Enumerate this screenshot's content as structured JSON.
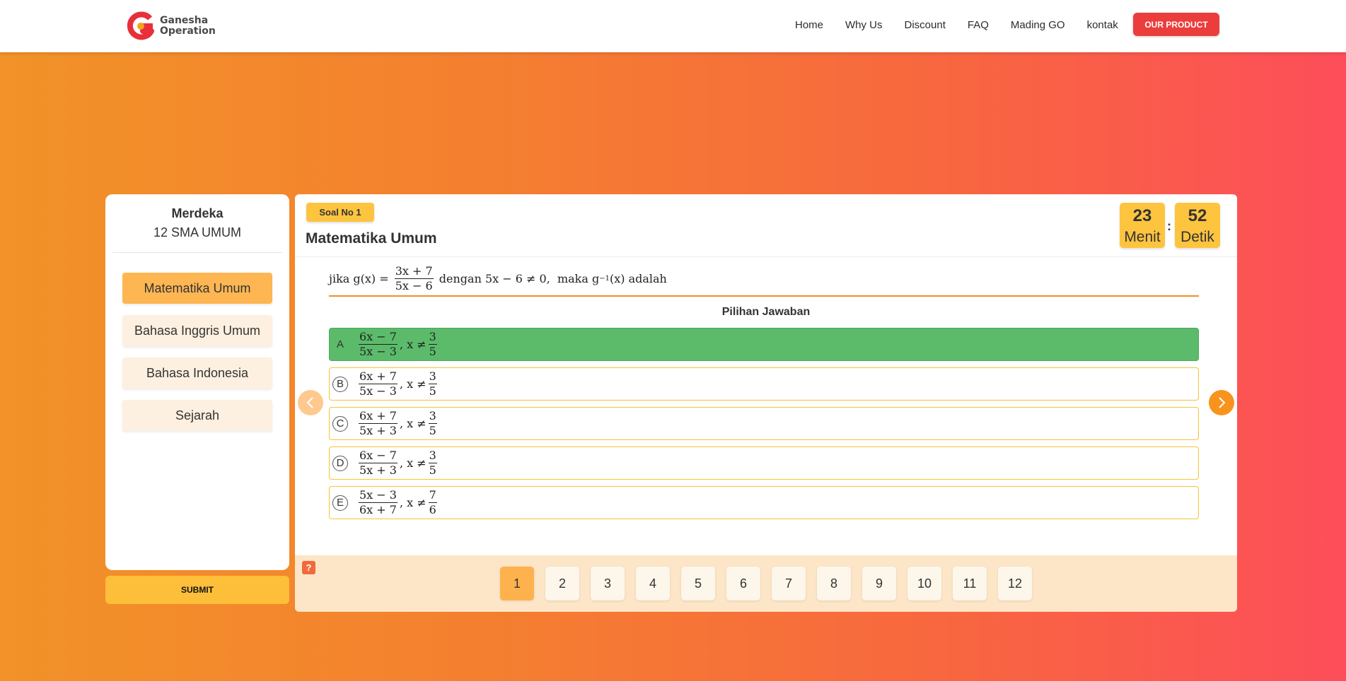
{
  "navbar": {
    "brand_line1": "Ganesha",
    "brand_line2": "Operation",
    "links": [
      "Home",
      "Why Us",
      "Discount",
      "FAQ",
      "Mading GO",
      "kontak"
    ],
    "cta_label": "OUR PRODUCT"
  },
  "sidebar": {
    "curriculum": "Merdeka",
    "class_name": "12 SMA UMUM",
    "subjects": [
      {
        "label": "Matematika Umum",
        "active": true
      },
      {
        "label": "Bahasa Inggris Umum",
        "active": false
      },
      {
        "label": "Bahasa Indonesia",
        "active": false
      },
      {
        "label": "Sejarah",
        "active": false
      }
    ],
    "submit_label": "SUBMIT"
  },
  "question": {
    "badge": "Soal No 1",
    "subject_title": "Matematika Umum",
    "text_prefix": "jika g(x) = ",
    "frac_num": "3x + 7",
    "frac_den": "5x − 6",
    "text_suffix": " dengan 5x − 6 ≠ 0,  maka g",
    "sup": "−1",
    "text_end": "(x) adalah"
  },
  "timer": {
    "minutes": "23",
    "minutes_label": "Menit",
    "seconds": "52",
    "seconds_label": "Detik",
    "separator": ":"
  },
  "answers": {
    "heading": "Pilihan Jawaban",
    "options": [
      {
        "letter": "A",
        "num": "6x − 7",
        "den": "5x − 3",
        "cond": ", x ≠",
        "cnum": "3",
        "cden": "5",
        "selected_correct": true
      },
      {
        "letter": "B",
        "num": "6x + 7",
        "den": "5x − 3",
        "cond": ", x ≠",
        "cnum": "3",
        "cden": "5",
        "selected_correct": false
      },
      {
        "letter": "C",
        "num": "6x + 7",
        "den": "5x + 3",
        "cond": ", x ≠",
        "cnum": "3",
        "cden": "5",
        "selected_correct": false
      },
      {
        "letter": "D",
        "num": "6x − 7",
        "den": "5x + 3",
        "cond": ", x ≠",
        "cnum": "3",
        "cden": "5",
        "selected_correct": false
      },
      {
        "letter": "E",
        "num": "5x − 3",
        "den": "6x + 7",
        "cond": ", x ≠",
        "cnum": "7",
        "cden": "6",
        "selected_correct": false
      }
    ]
  },
  "navigation": {
    "prev_icon": "chevron-left-icon",
    "next_icon": "chevron-right-icon",
    "help_label": "?",
    "pages": [
      "1",
      "2",
      "3",
      "4",
      "5",
      "6",
      "7",
      "8",
      "9",
      "10",
      "11",
      "12"
    ],
    "active_page": "1"
  },
  "colors": {
    "brand_red": "#ec3d3d",
    "accent_yellow": "#fdc43f",
    "correct_green": "#5bbb6a",
    "gradient_start": "#f29228",
    "gradient_end": "#fd4e5a"
  }
}
